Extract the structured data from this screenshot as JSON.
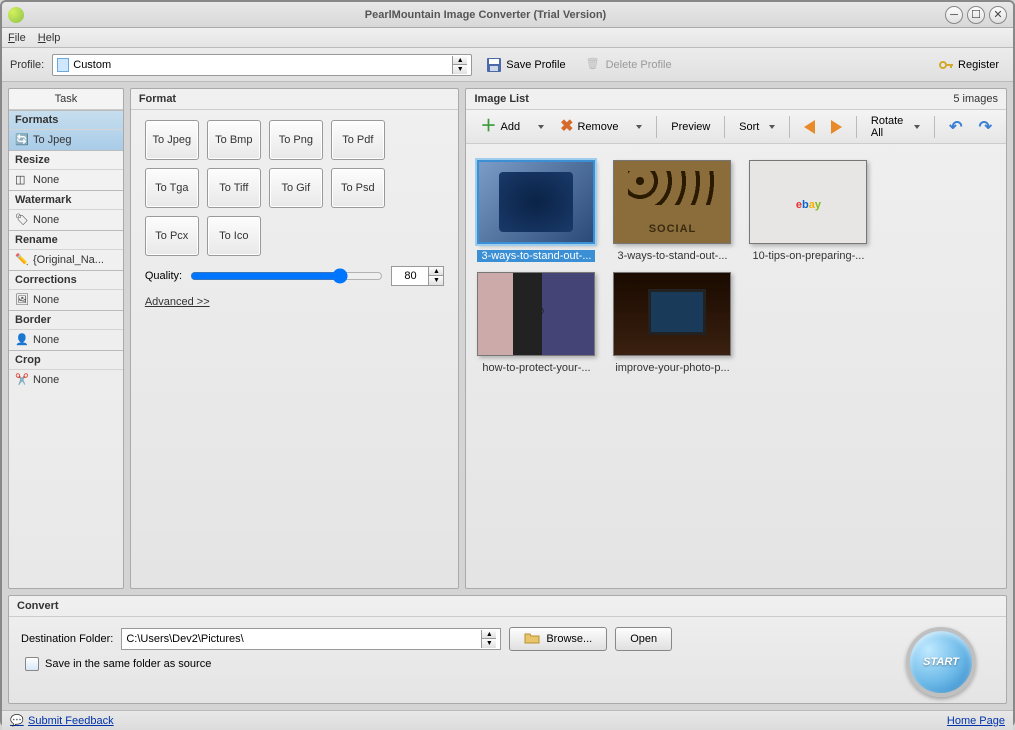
{
  "window": {
    "title": "PearlMountain Image Converter (Trial Version)"
  },
  "menu": {
    "file": "File",
    "help": "Help"
  },
  "profile": {
    "label": "Profile:",
    "value": "Custom",
    "save": "Save Profile",
    "delete": "Delete Profile",
    "register": "Register"
  },
  "tasks": {
    "title": "Task",
    "items": [
      {
        "header": "Formats",
        "value": "To Jpeg",
        "selected": true
      },
      {
        "header": "Resize",
        "value": "None"
      },
      {
        "header": "Watermark",
        "value": "None"
      },
      {
        "header": "Rename",
        "value": "{Original_Na..."
      },
      {
        "header": "Corrections",
        "value": "None"
      },
      {
        "header": "Border",
        "value": "None"
      },
      {
        "header": "Crop",
        "value": "None"
      }
    ]
  },
  "format": {
    "title": "Format",
    "buttons": [
      "To Jpeg",
      "To Bmp",
      "To Png",
      "To Pdf",
      "To Tga",
      "To Tiff",
      "To Gif",
      "To Psd",
      "To Pcx",
      "To Ico"
    ],
    "quality_label": "Quality:",
    "quality_value": "80",
    "advanced": "Advanced >>"
  },
  "imagelist": {
    "title": "Image List",
    "count": "5 images",
    "toolbar": {
      "add": "Add",
      "remove": "Remove",
      "preview": "Preview",
      "sort": "Sort",
      "rotate_all": "Rotate All"
    },
    "items": [
      {
        "label": "3-ways-to-stand-out-...",
        "selected": true
      },
      {
        "label": "3-ways-to-stand-out-..."
      },
      {
        "label": "10-tips-on-preparing-..."
      },
      {
        "label": "how-to-protect-your-..."
      },
      {
        "label": "improve-your-photo-p..."
      }
    ]
  },
  "convert": {
    "title": "Convert",
    "dest_label": "Destination Folder:",
    "dest_value": "C:\\Users\\Dev2\\Pictures\\",
    "browse": "Browse...",
    "open": "Open",
    "same_folder": "Save in the same folder as source",
    "start": "START"
  },
  "status": {
    "feedback": "Submit Feedback",
    "home": "Home Page"
  }
}
